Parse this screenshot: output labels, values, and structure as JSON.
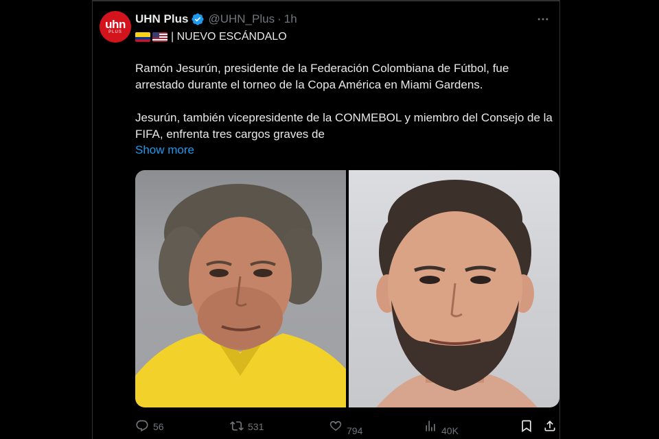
{
  "tweet": {
    "display_name": "UHN Plus",
    "handle": "@UHN_Plus",
    "separator": "·",
    "time": "1h",
    "subtitle": "| NUEVO ESCÁNDALO",
    "paragraph_1": "Ramón Jesurún, presidente de la Federación Colombiana de Fútbol, fue arrestado durante el torneo de la Copa América en Miami Gardens.",
    "paragraph_2": "Jesurún, también vicepresidente de la CONMEBOL y miembro del Consejo de la FIFA, enfrenta tres cargos graves de",
    "show_more": "Show more",
    "avatar": {
      "logo_main": "uhn",
      "logo_sub": "PLUS"
    }
  },
  "actions": {
    "replies": "56",
    "reposts": "531",
    "likes": "794",
    "views": "40K"
  },
  "icons": {
    "verified": "verified-badge-icon",
    "more": "more-horizontal-icon",
    "reply": "reply-icon",
    "repost": "repost-icon",
    "like": "heart-icon",
    "views": "views-chart-icon",
    "bookmark": "bookmark-icon",
    "share": "share-icon"
  },
  "colors": {
    "background": "#000000",
    "text": "#e7e9ea",
    "muted": "#71767b",
    "link": "#1d9bf0",
    "verified": "#1d9bf0",
    "brand": "#d3141d"
  }
}
